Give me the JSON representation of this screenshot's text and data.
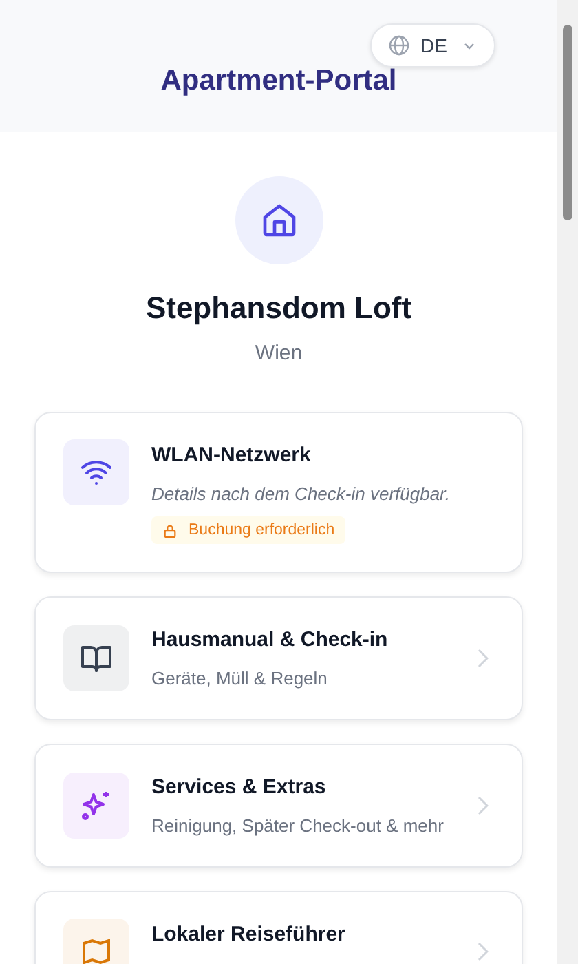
{
  "header": {
    "title": "Apartment-Portal",
    "language": "DE"
  },
  "property": {
    "name": "Stephansdom Loft",
    "city": "Wien"
  },
  "cards": [
    {
      "kind": "locked",
      "title": "WLAN-Netzwerk",
      "subtitle": "Details nach dem Check-in verfügbar.",
      "badge": "Buchung erforderlich",
      "color": "#4f46e5"
    },
    {
      "kind": "link",
      "title": "Hausmanual & Check-in",
      "subtitle": "Geräte, Müll & Regeln",
      "color": "#374151"
    },
    {
      "kind": "link",
      "title": "Services & Extras",
      "subtitle": "Reinigung, Später Check-out & mehr",
      "color": "#9333ea"
    },
    {
      "kind": "link",
      "title": "Lokaler Reiseführer",
      "color": "#d97706"
    }
  ]
}
